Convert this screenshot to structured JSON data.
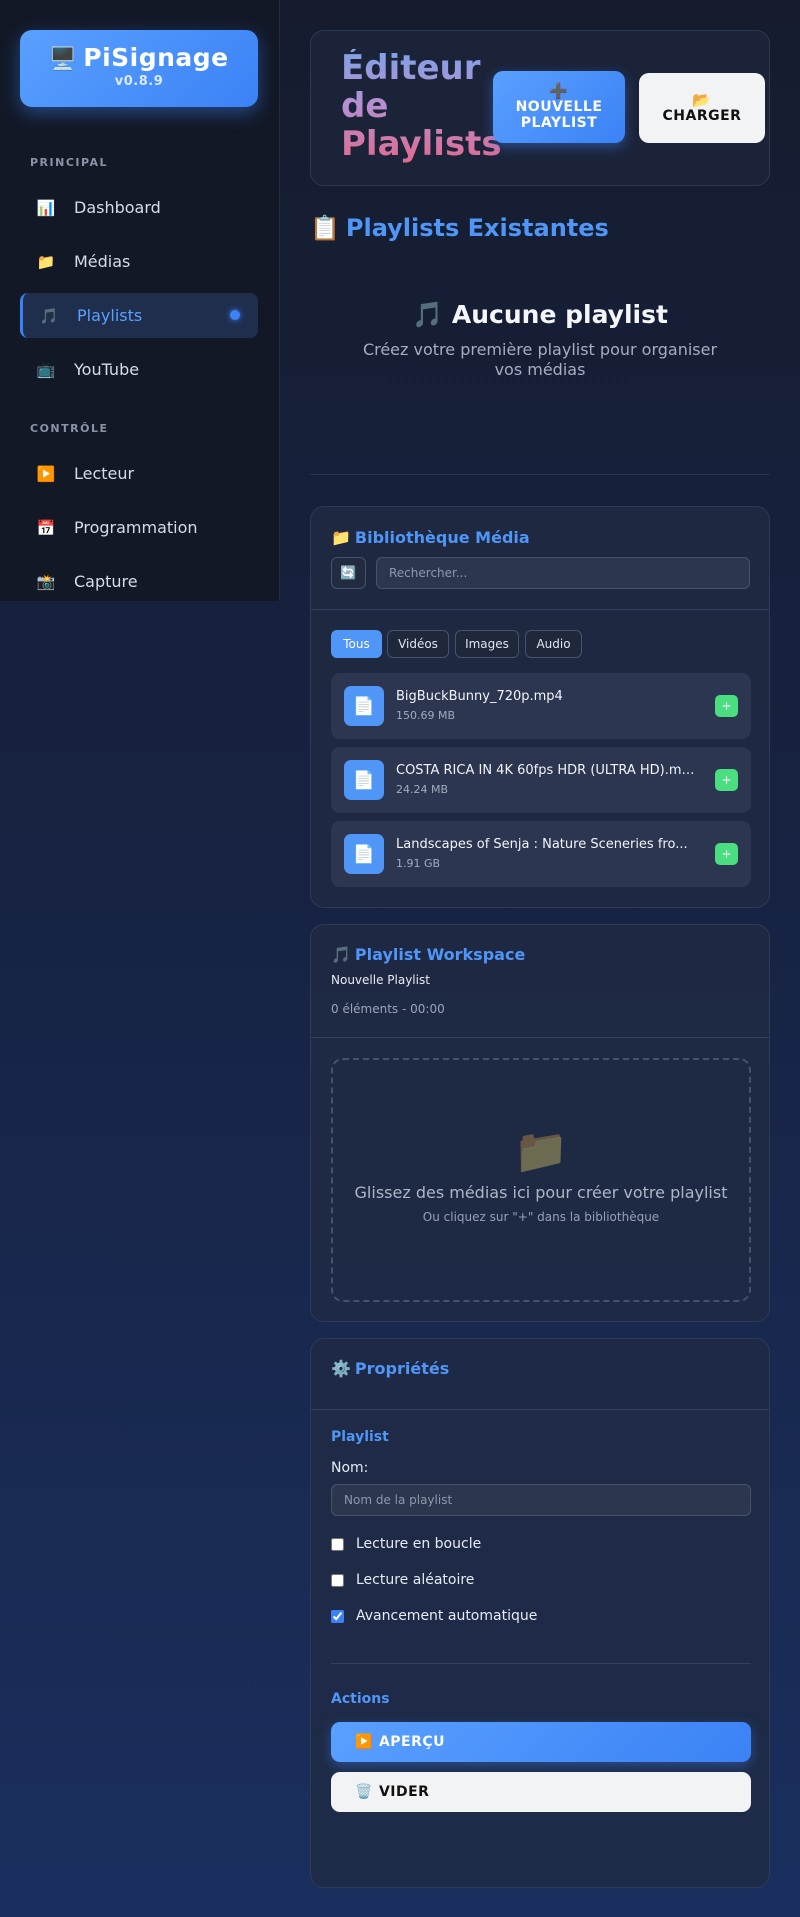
{
  "app": {
    "logo_icon": "🖥️",
    "name": "PiSignage",
    "version": "v0.8.9"
  },
  "sidebar": {
    "sections": [
      {
        "title": "PRINCIPAL"
      },
      {
        "title": "CONTRÔLE"
      }
    ],
    "items": [
      {
        "icon": "📊",
        "icon_name": "chart-icon",
        "label": "Dashboard"
      },
      {
        "icon": "📁",
        "icon_name": "folder-icon",
        "label": "Médias"
      },
      {
        "icon": "🎵",
        "icon_name": "music-icon",
        "label": "Playlists",
        "active": true
      },
      {
        "icon": "📺",
        "icon_name": "tv-icon",
        "label": "YouTube"
      },
      {
        "icon": "▶️",
        "icon_name": "play-icon",
        "label": "Lecteur"
      },
      {
        "icon": "📅",
        "icon_name": "calendar-icon",
        "label": "Programmation"
      },
      {
        "icon": "📸",
        "icon_name": "camera-icon",
        "label": "Capture"
      }
    ]
  },
  "header": {
    "title": "Éditeur de Playlists",
    "new_button": {
      "icon": "➕",
      "label": "NOUVELLE PLAYLIST"
    },
    "load_button": {
      "icon": "📂",
      "label": "CHARGER"
    }
  },
  "existing": {
    "icon": "📋",
    "title": "Playlists Existantes",
    "empty_icon": "🎵",
    "empty_title": "Aucune playlist",
    "empty_subtitle": "Créez votre première playlist pour organiser vos médias"
  },
  "library": {
    "icon": "📁",
    "title": "Bibliothèque Média",
    "refresh_icon": "🔄",
    "search_placeholder": "Rechercher...",
    "filters": [
      "Tous",
      "Vidéos",
      "Images",
      "Audio"
    ],
    "active_filter": "Tous",
    "items": [
      {
        "icon": "📄",
        "name": "BigBuckBunny_720p.mp4",
        "size": "150.69 MB",
        "add_label": "+"
      },
      {
        "icon": "📄",
        "name": "COSTA RICA IN 4K 60fps HDR (ULTRA HD).mp4",
        "size": "24.24 MB",
        "add_label": "+"
      },
      {
        "icon": "📄",
        "name": "Landscapes of Senja :  Nature Sceneries fro...",
        "size": "1.91 GB",
        "add_label": "+"
      }
    ]
  },
  "workspace": {
    "icon": "🎵",
    "title": "Playlist Workspace",
    "playlist_name": "Nouvelle Playlist",
    "meta": "0 éléments - 00:00",
    "drop_icon": "📁",
    "drop_text": "Glissez des médias ici pour créer votre playlist",
    "drop_hint": "Ou cliquez sur \"+\" dans la bibliothèque"
  },
  "properties": {
    "icon": "⚙️",
    "title": "Propriétés",
    "playlist_heading": "Playlist",
    "name_label": "Nom:",
    "name_placeholder": "Nom de la playlist",
    "options": [
      {
        "label": "Lecture en boucle",
        "checked": false
      },
      {
        "label": "Lecture aléatoire",
        "checked": false
      },
      {
        "label": "Avancement automatique",
        "checked": true
      }
    ],
    "actions_heading": "Actions",
    "preview_button": {
      "icon": "▶️",
      "label": "APERÇU"
    },
    "clear_button": {
      "icon": "🗑️",
      "label": "VIDER"
    }
  },
  "colors": {
    "accent": "#3b82f6",
    "accent_light": "#4f96f7",
    "success": "#4ade80",
    "sidebar_bg": "#121826"
  }
}
